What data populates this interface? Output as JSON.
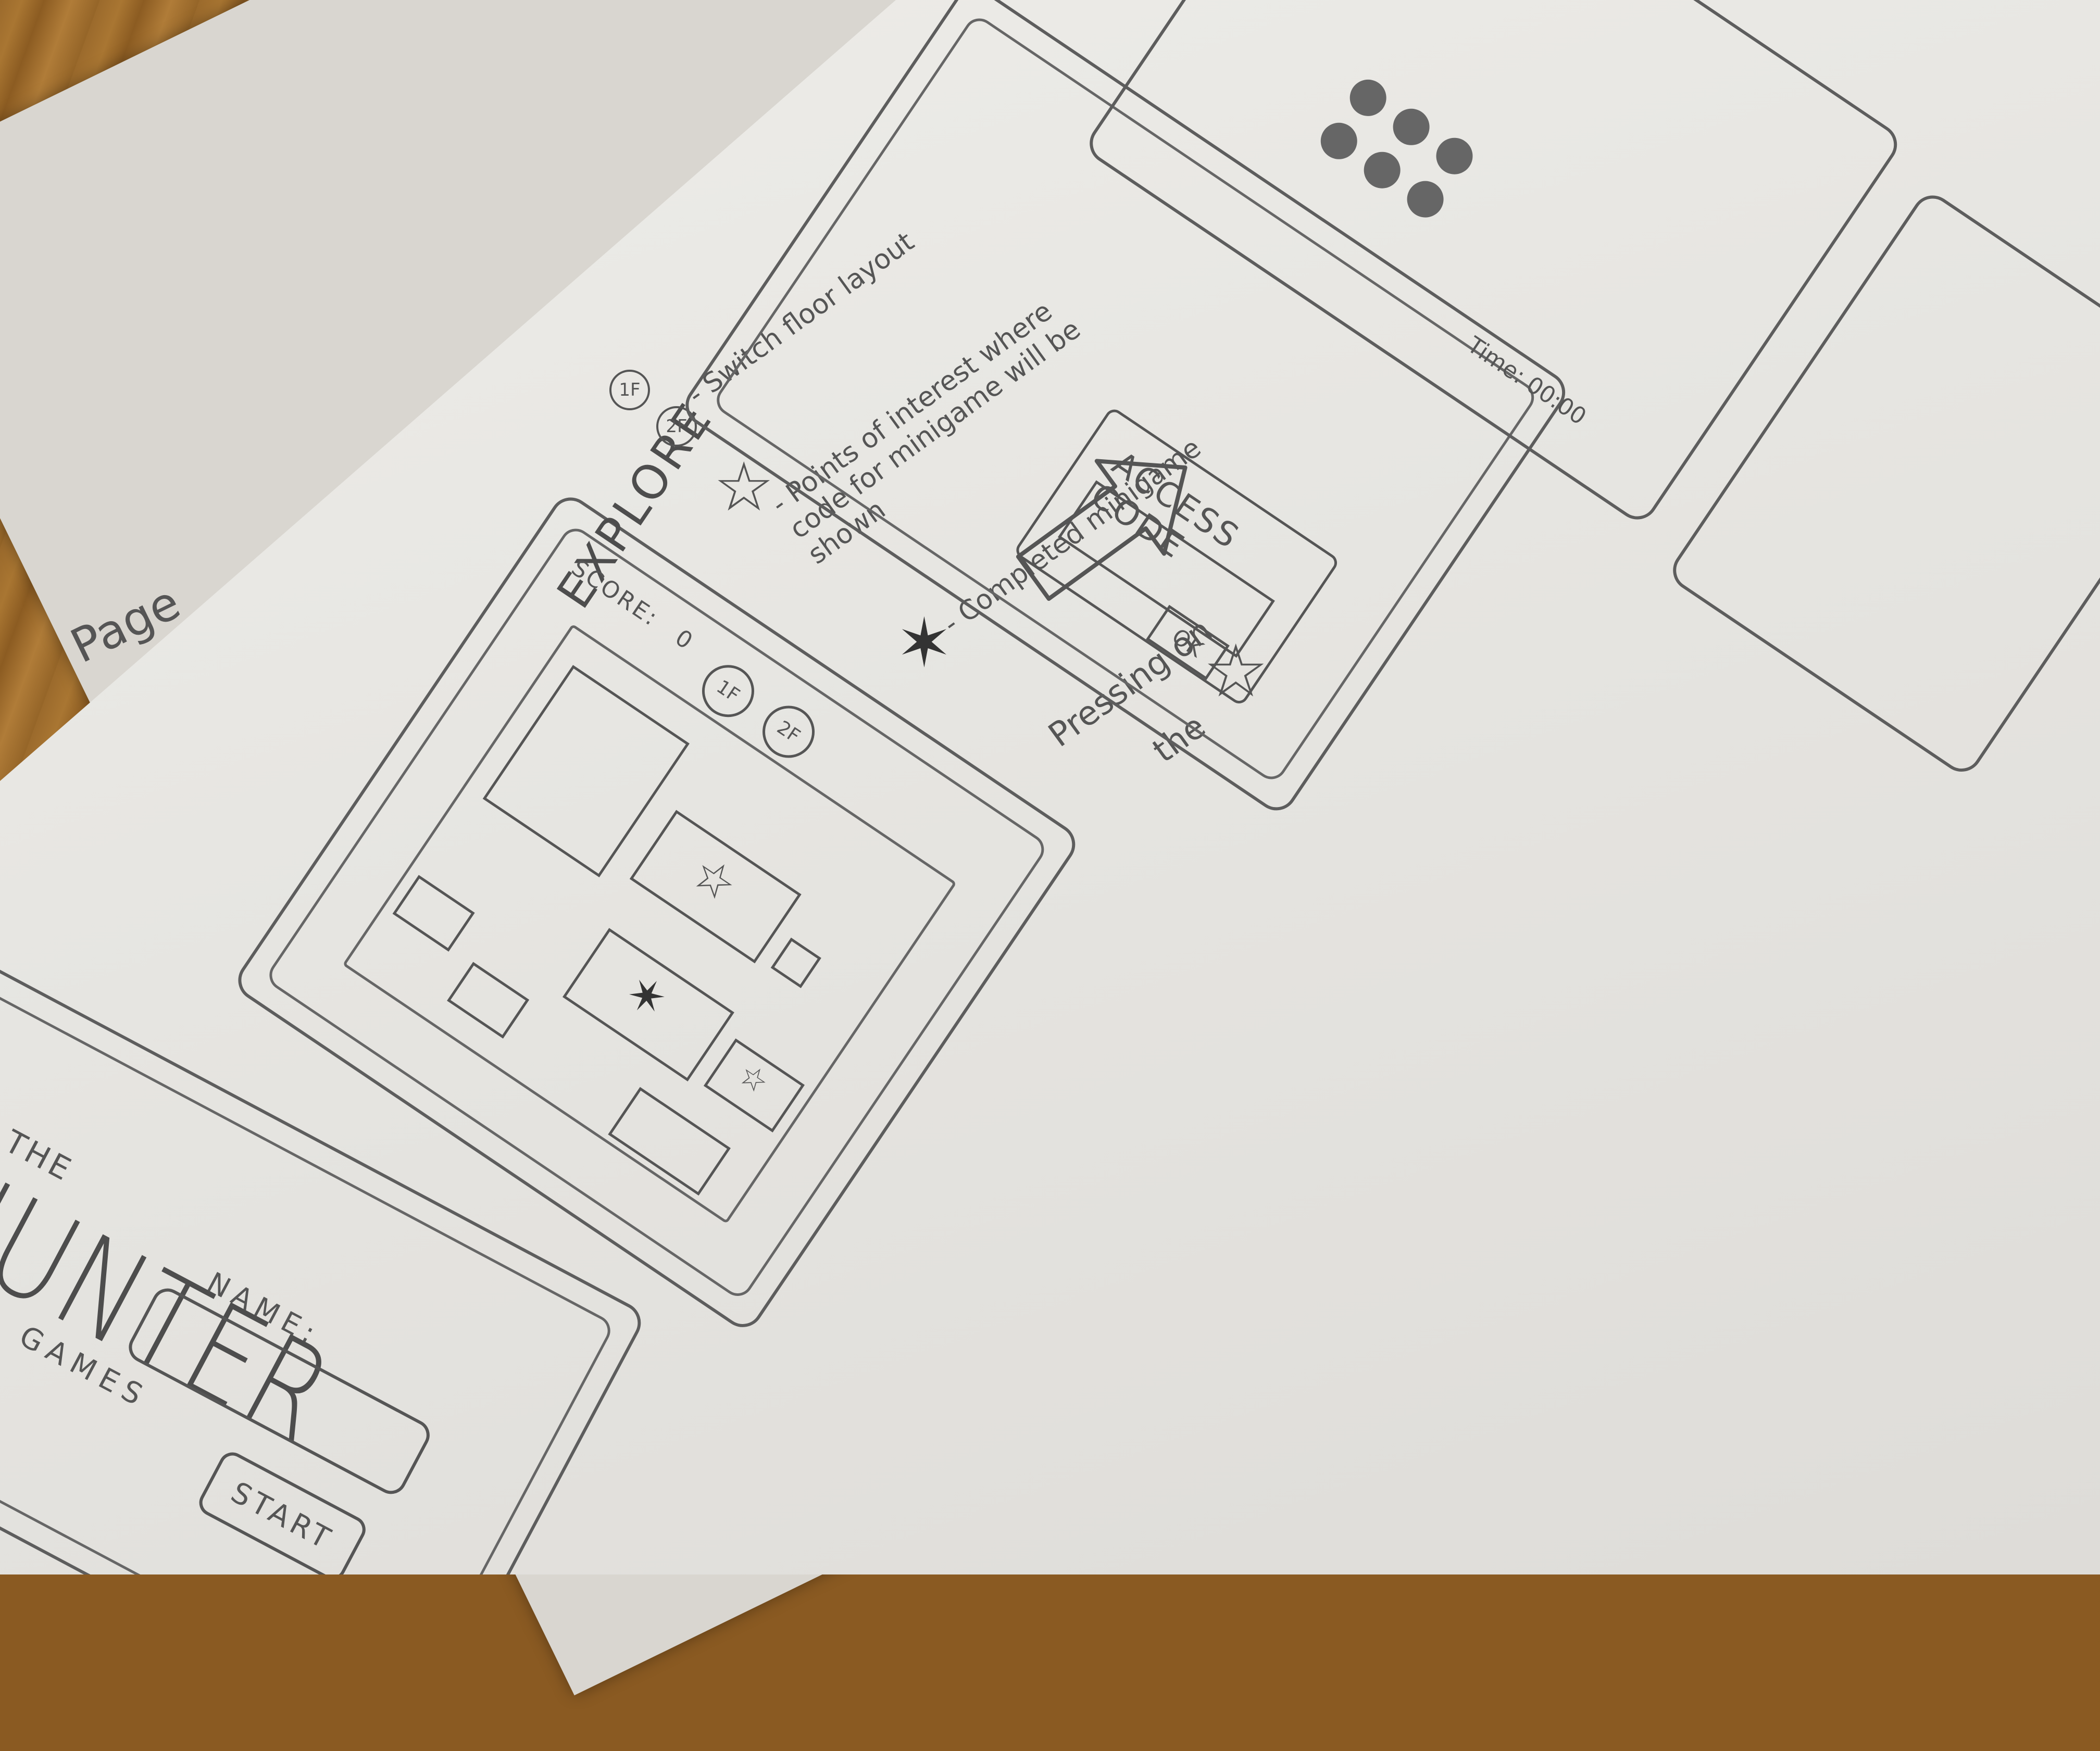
{
  "start_screen": {
    "title_prefix": "THE",
    "title_main": "HUNTER",
    "title_suffix": "GAMES",
    "name_label": "NAME:",
    "name_value": "",
    "start_button": "START"
  },
  "explore_screen": {
    "title": "EXPLORE",
    "score_label": "SCORE:",
    "score_value": "0",
    "floor_buttons": [
      "1F",
      "2F"
    ]
  },
  "legend": {
    "floor_icons": [
      "1F",
      "2F"
    ],
    "floor_desc": "- Switch floor layout",
    "poi_desc": "- Points of interest where code for minigame will be shown",
    "completed_desc": "- Completed minigame",
    "star_icon": "star-icon",
    "completed_icon": "scribbled-star-icon"
  },
  "arrow_note": {
    "line1": "Pressing on",
    "line2": "the"
  },
  "access_screen": {
    "title": "ACCESS CODE",
    "input_value": "",
    "ok_button": "OK"
  },
  "minigame_screen": {
    "timer": "Time: 00:00"
  },
  "page_note": "Page"
}
